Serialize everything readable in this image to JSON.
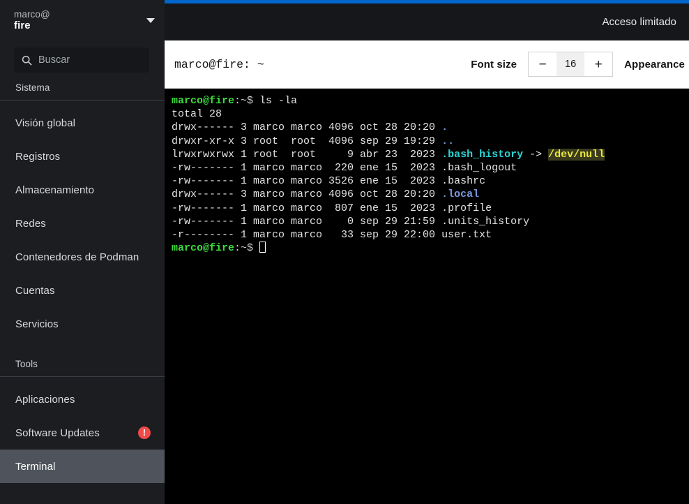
{
  "sidebar": {
    "host": {
      "user": "marco@",
      "machine": "fire",
      "caret_icon": "chevron-down-icon"
    },
    "search": {
      "placeholder": "Buscar",
      "value": "",
      "icon": "search-icon"
    },
    "sections": [
      {
        "title": "Sistema",
        "items": [
          {
            "label": "Visión global",
            "selected": false,
            "badge": ""
          },
          {
            "label": "Registros",
            "selected": false,
            "badge": ""
          },
          {
            "label": "Almacenamiento",
            "selected": false,
            "badge": ""
          },
          {
            "label": "Redes",
            "selected": false,
            "badge": ""
          },
          {
            "label": "Contenedores de Podman",
            "selected": false,
            "badge": ""
          },
          {
            "label": "Cuentas",
            "selected": false,
            "badge": ""
          },
          {
            "label": "Servicios",
            "selected": false,
            "badge": ""
          }
        ]
      },
      {
        "title": "Tools",
        "items": [
          {
            "label": "Aplicaciones",
            "selected": false,
            "badge": ""
          },
          {
            "label": "Software Updates",
            "selected": false,
            "badge": "!"
          },
          {
            "label": "Terminal",
            "selected": true,
            "badge": ""
          }
        ]
      }
    ]
  },
  "header": {
    "accent_color": "#0066cc",
    "limited_access": "Acceso limitado"
  },
  "toolbar": {
    "title": "marco@fire: ~",
    "font_size_label": "Font size",
    "decrease_label": "−",
    "font_size_value": "16",
    "increase_label": "+",
    "appearance_label": "Appearance"
  },
  "terminal": {
    "prompt_user_host": "marco@fire",
    "prompt_tail": ":~$ ",
    "command": "ls -la",
    "total_line": "total 28",
    "rows": [
      {
        "perms": "drwx------",
        "links": "3",
        "owner": "marco",
        "group": "marco",
        "size": "4096",
        "month": "oct",
        "day": "28",
        "time": "20:20",
        "name": ".",
        "kind": "dir-dot"
      },
      {
        "perms": "drwxr-xr-x",
        "links": "3",
        "owner": "root ",
        "group": "root ",
        "size": "4096",
        "month": "sep",
        "day": "29",
        "time": "19:29",
        "name": "..",
        "kind": "dir-dot"
      },
      {
        "perms": "lrwxrwxrwx",
        "links": "1",
        "owner": "root ",
        "group": "root ",
        "size": "   9",
        "month": "abr",
        "day": "23",
        "time": " 2023",
        "name": ".bash_history",
        "kind": "symlink",
        "target": "/dev/null"
      },
      {
        "perms": "-rw-------",
        "links": "1",
        "owner": "marco",
        "group": "marco",
        "size": " 220",
        "month": "ene",
        "day": "15",
        "time": " 2023",
        "name": ".bash_logout",
        "kind": "file"
      },
      {
        "perms": "-rw-------",
        "links": "1",
        "owner": "marco",
        "group": "marco",
        "size": "3526",
        "month": "ene",
        "day": "15",
        "time": " 2023",
        "name": ".bashrc",
        "kind": "file"
      },
      {
        "perms": "drwx------",
        "links": "3",
        "owner": "marco",
        "group": "marco",
        "size": "4096",
        "month": "oct",
        "day": "28",
        "time": "20:20",
        "name": ".local",
        "kind": "dir"
      },
      {
        "perms": "-rw-------",
        "links": "1",
        "owner": "marco",
        "group": "marco",
        "size": " 807",
        "month": "ene",
        "day": "15",
        "time": " 2023",
        "name": ".profile",
        "kind": "file"
      },
      {
        "perms": "-rw-------",
        "links": "1",
        "owner": "marco",
        "group": "marco",
        "size": "   0",
        "month": "sep",
        "day": "29",
        "time": "21:59",
        "name": ".units_history",
        "kind": "file"
      },
      {
        "perms": "-r--------",
        "links": "1",
        "owner": "marco",
        "group": "marco",
        "size": "  33",
        "month": "sep",
        "day": "29",
        "time": "22:00",
        "name": "user.txt",
        "kind": "file"
      }
    ],
    "symlink_arrow": " -> ",
    "colors": {
      "prompt": "#3ddb3d",
      "text": "#e3e3e3",
      "symlink": "#2ad4d4",
      "directory": "#7a9ae0",
      "orphan_fg": "#e8e83c",
      "orphan_bg": "#3b3b1e",
      "background": "#000000"
    }
  }
}
